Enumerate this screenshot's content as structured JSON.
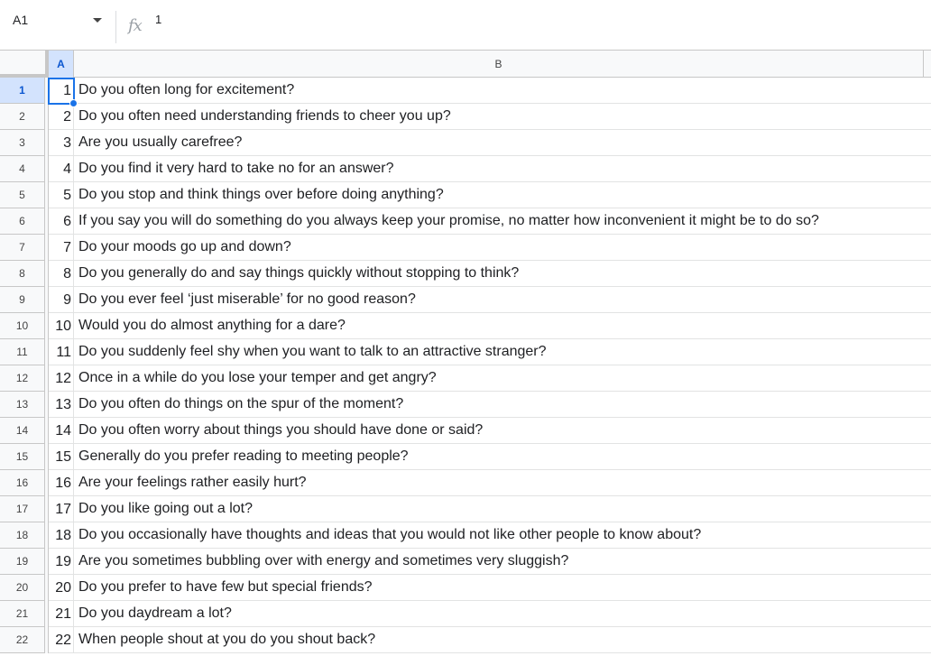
{
  "formula_bar": {
    "name_box": "A1",
    "fx_icon": "fx-icon",
    "value": "1"
  },
  "columns": [
    "A",
    "B"
  ],
  "rows": [
    {
      "row": "1",
      "a": "1",
      "b": "Do you often long for excitement?"
    },
    {
      "row": "2",
      "a": "2",
      "b": "Do you often need understanding friends to cheer you up?"
    },
    {
      "row": "3",
      "a": "3",
      "b": "Are you usually carefree?"
    },
    {
      "row": "4",
      "a": "4",
      "b": "Do you find it very hard to take no for an answer?"
    },
    {
      "row": "5",
      "a": "5",
      "b": "Do you stop and think things over before doing anything?"
    },
    {
      "row": "6",
      "a": "6",
      "b": "If you say you will do something do you always keep your promise, no matter how inconvenient it might be to do so?"
    },
    {
      "row": "7",
      "a": "7",
      "b": "Do your moods go up and down?"
    },
    {
      "row": "8",
      "a": "8",
      "b": "Do you generally do and say things quickly without stopping to think?"
    },
    {
      "row": "9",
      "a": "9",
      "b": "Do you ever feel ‘just miserable’ for no good reason?"
    },
    {
      "row": "10",
      "a": "10",
      "b": "Would you do almost anything for a dare?"
    },
    {
      "row": "11",
      "a": "11",
      "b": "Do you suddenly feel shy when you want to talk to an attractive stranger?"
    },
    {
      "row": "12",
      "a": "12",
      "b": "Once in a while do you lose your temper and get angry?"
    },
    {
      "row": "13",
      "a": "13",
      "b": "Do you often do things on the spur of the moment?"
    },
    {
      "row": "14",
      "a": "14",
      "b": "Do you often worry about things you should have done or said?"
    },
    {
      "row": "15",
      "a": "15",
      "b": "Generally do you prefer reading to meeting people?"
    },
    {
      "row": "16",
      "a": "16",
      "b": "Are your feelings rather easily hurt?"
    },
    {
      "row": "17",
      "a": "17",
      "b": "Do you like going out a lot?"
    },
    {
      "row": "18",
      "a": "18",
      "b": "Do you occasionally have thoughts and ideas that you would not like other people to know about?"
    },
    {
      "row": "19",
      "a": "19",
      "b": "Are you sometimes bubbling over with energy and sometimes very sluggish?"
    },
    {
      "row": "20",
      "a": "20",
      "b": "Do you prefer to have few but special friends?"
    },
    {
      "row": "21",
      "a": "21",
      "b": "Do you daydream a lot?"
    },
    {
      "row": "22",
      "a": "22",
      "b": "When people shout at you do you shout back?"
    }
  ],
  "colors": {
    "selection": "#1a73e8",
    "header_active_bg": "#d3e3fd",
    "header_bg": "#f8f9fa"
  }
}
